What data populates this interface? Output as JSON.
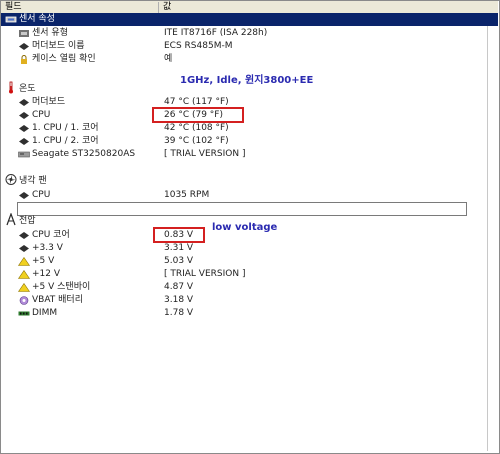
{
  "header": {
    "col_field": "필드",
    "col_value": "값"
  },
  "groups": {
    "sensor": {
      "title": "센서 속성",
      "rows": [
        {
          "label": "센서 유형",
          "value": "ITE IT8716F  (ISA 228h)"
        },
        {
          "label": "머더보드 이름",
          "value": "ECS RS485M-M"
        },
        {
          "label": "케이스 열림 확인",
          "value": "예"
        }
      ]
    },
    "temp": {
      "title": "온도",
      "rows": [
        {
          "label": "머더보드",
          "value": "47 °C  (117 °F)"
        },
        {
          "label": "CPU",
          "value": "26 °C  (79 °F)"
        },
        {
          "label": "1. CPU / 1. 코어",
          "value": "42 °C  (108 °F)"
        },
        {
          "label": "1. CPU / 2. 코어",
          "value": "39 °C  (102 °F)"
        },
        {
          "label": "Seagate ST3250820AS",
          "value": "[ TRIAL VERSION ]"
        }
      ]
    },
    "fan": {
      "title": "냉각 팬",
      "rows": [
        {
          "label": "CPU",
          "value": "1035 RPM"
        }
      ]
    },
    "voltage": {
      "title": "전압",
      "rows": [
        {
          "label": "CPU 코어",
          "value": "0.83 V"
        },
        {
          "label": "+3.3 V",
          "value": "3.31 V"
        },
        {
          "label": "+5 V",
          "value": "5.03 V"
        },
        {
          "label": "+12 V",
          "value": "[ TRIAL VERSION ]"
        },
        {
          "label": "+5 V 스탠바이",
          "value": "4.87 V"
        },
        {
          "label": "VBAT 배터리",
          "value": "3.18 V"
        },
        {
          "label": "DIMM",
          "value": "1.78 V"
        }
      ]
    }
  },
  "annotations": {
    "note_top": "1GHz, Idle, 윈지3800+EE",
    "note_voltage": "low voltage"
  },
  "icons": {
    "sensor_group": "sensor-icon",
    "temp_group": "thermometer-icon",
    "fan_group": "fan-icon",
    "voltage_group": "voltage-icon",
    "chip": "chip-icon",
    "lock": "lock-icon",
    "warning": "warning-triangle-icon",
    "battery": "battery-icon",
    "memory": "memory-icon",
    "hdd": "hard-drive-icon"
  },
  "colors": {
    "selection": "#0a246a",
    "highlight_box": "#d42020",
    "annotation_text": "#2a2ab0",
    "header_bg": "#ece9d8"
  }
}
